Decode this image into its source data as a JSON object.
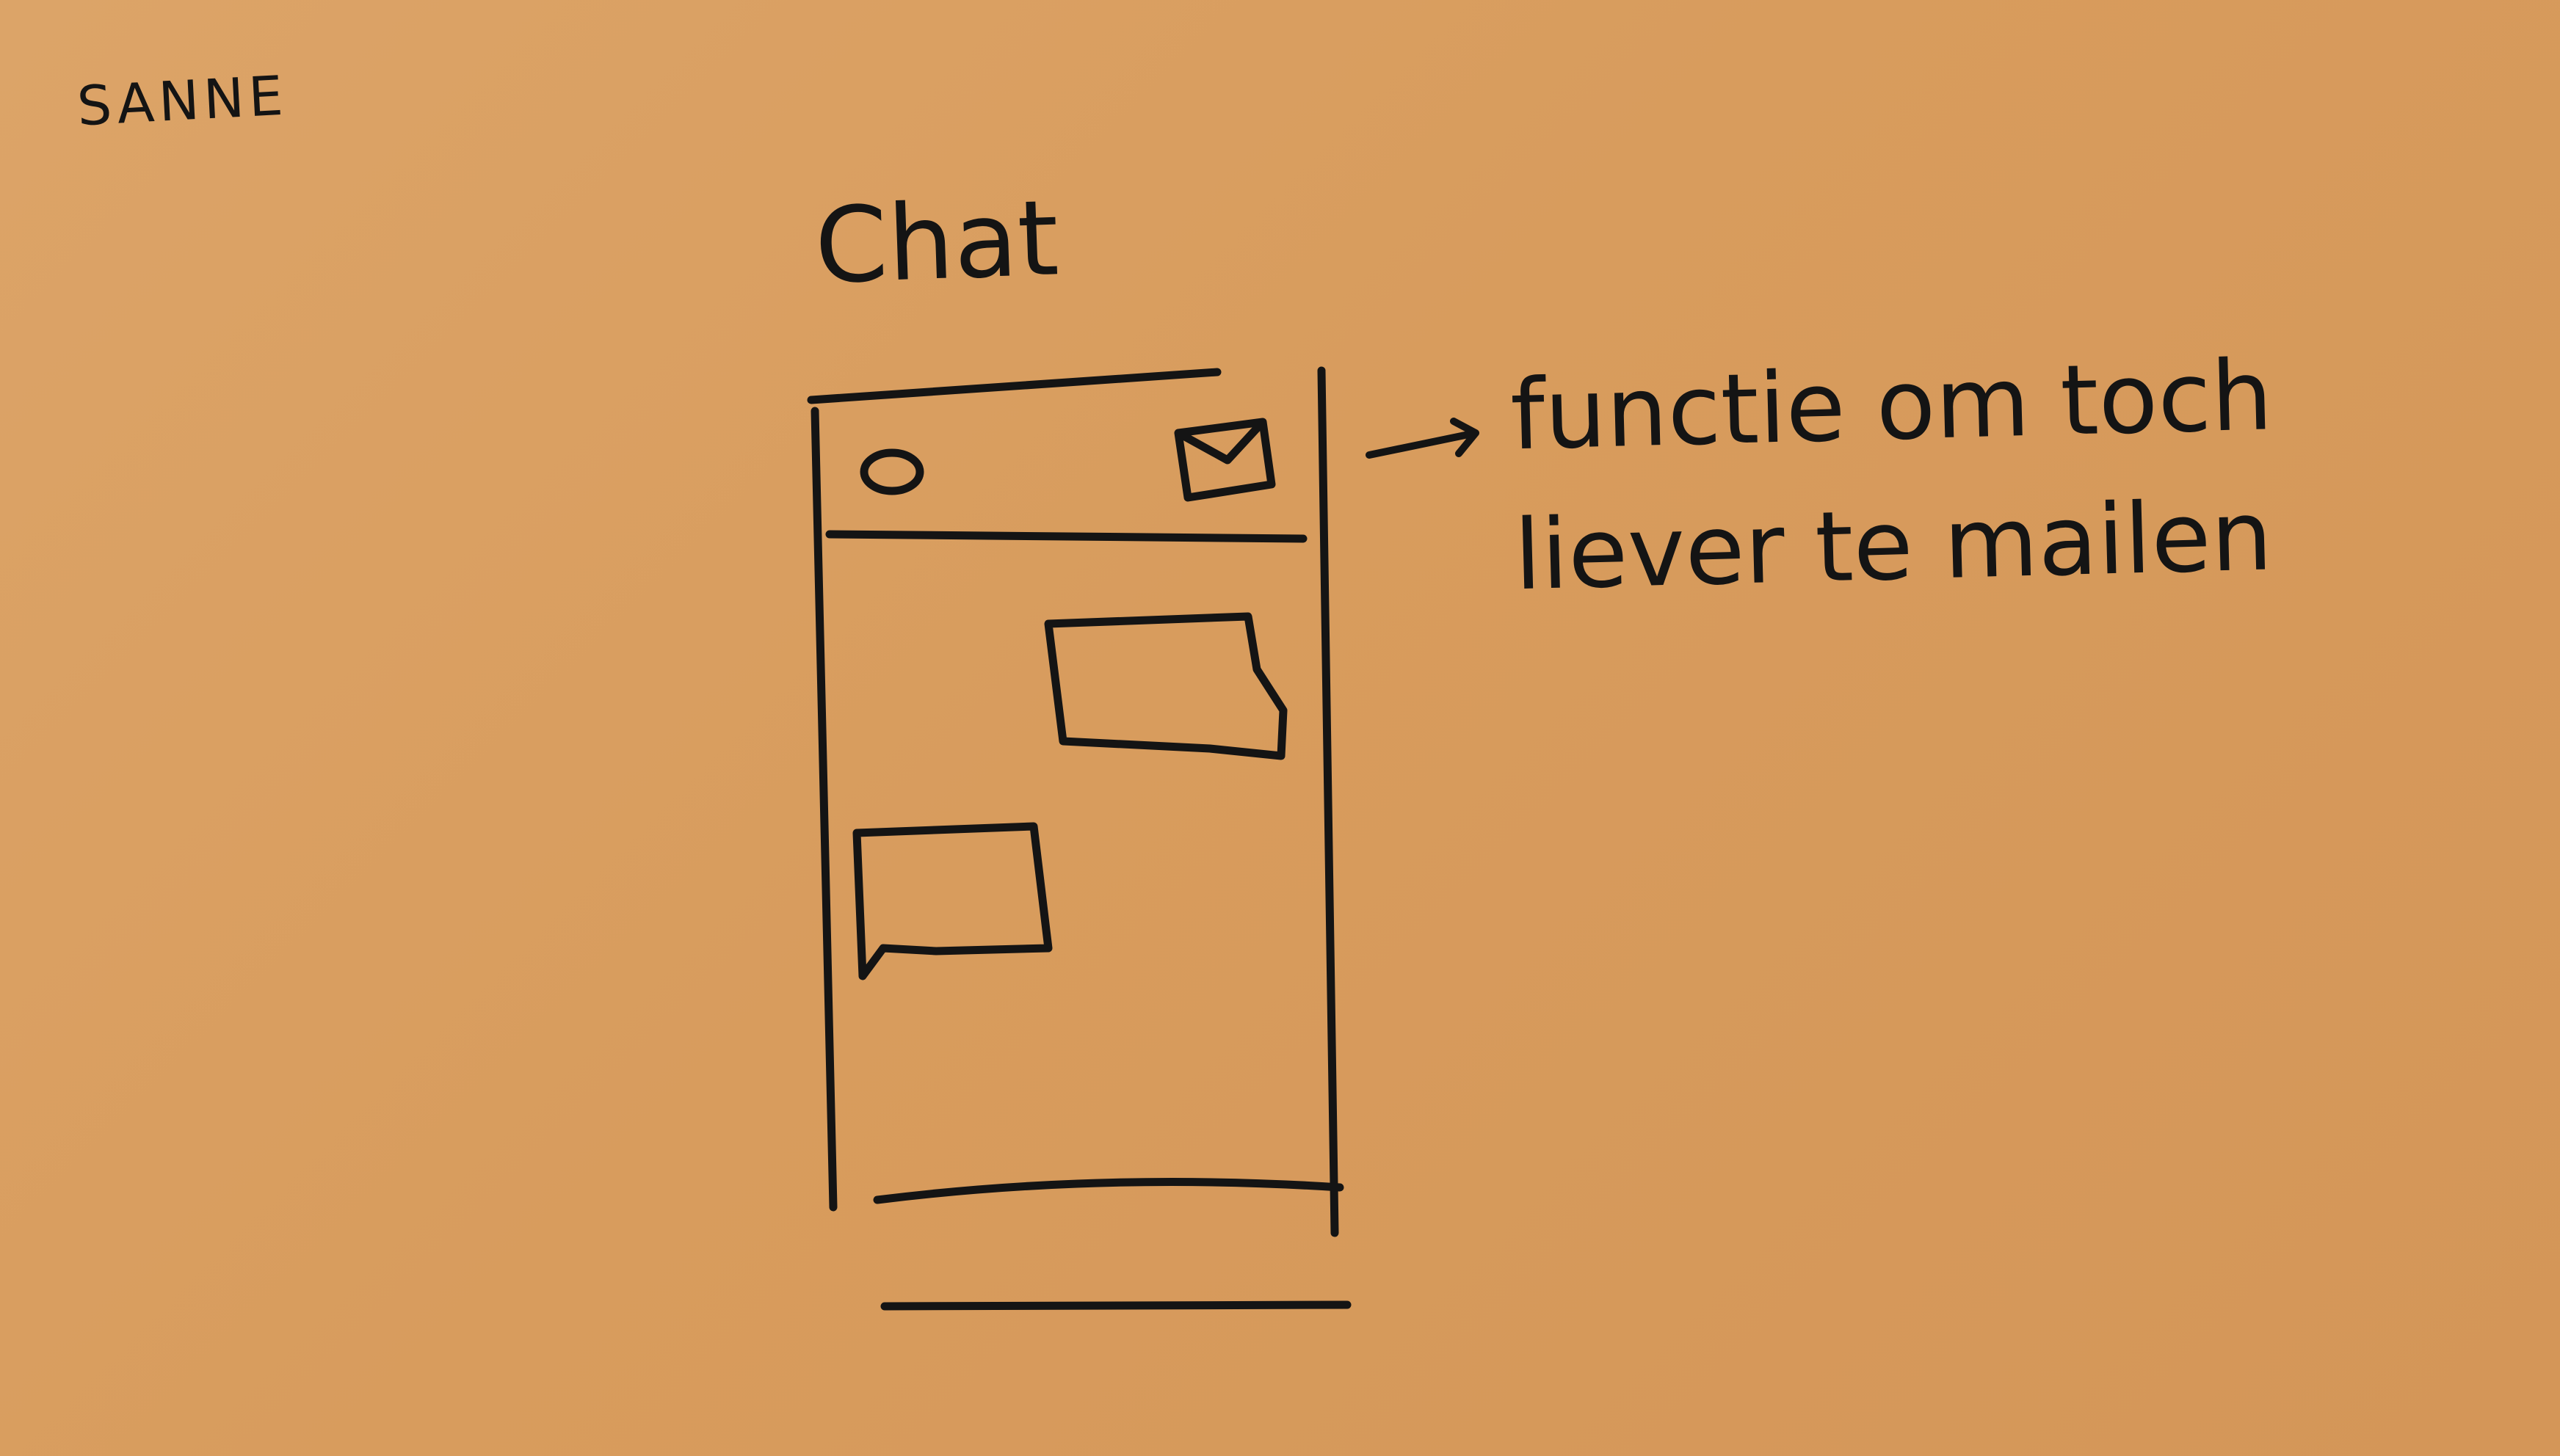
{
  "sketch": {
    "author": "SANNE",
    "title": "Chat",
    "annotation": "functie om toch liever te mailen"
  },
  "icons": {
    "profile": "profile-icon",
    "mail": "mail-icon",
    "arrow": "arrow-icon"
  },
  "colors": {
    "paper": "#d89c5d",
    "ink": "#141414",
    "background": "#8fb3d6"
  }
}
